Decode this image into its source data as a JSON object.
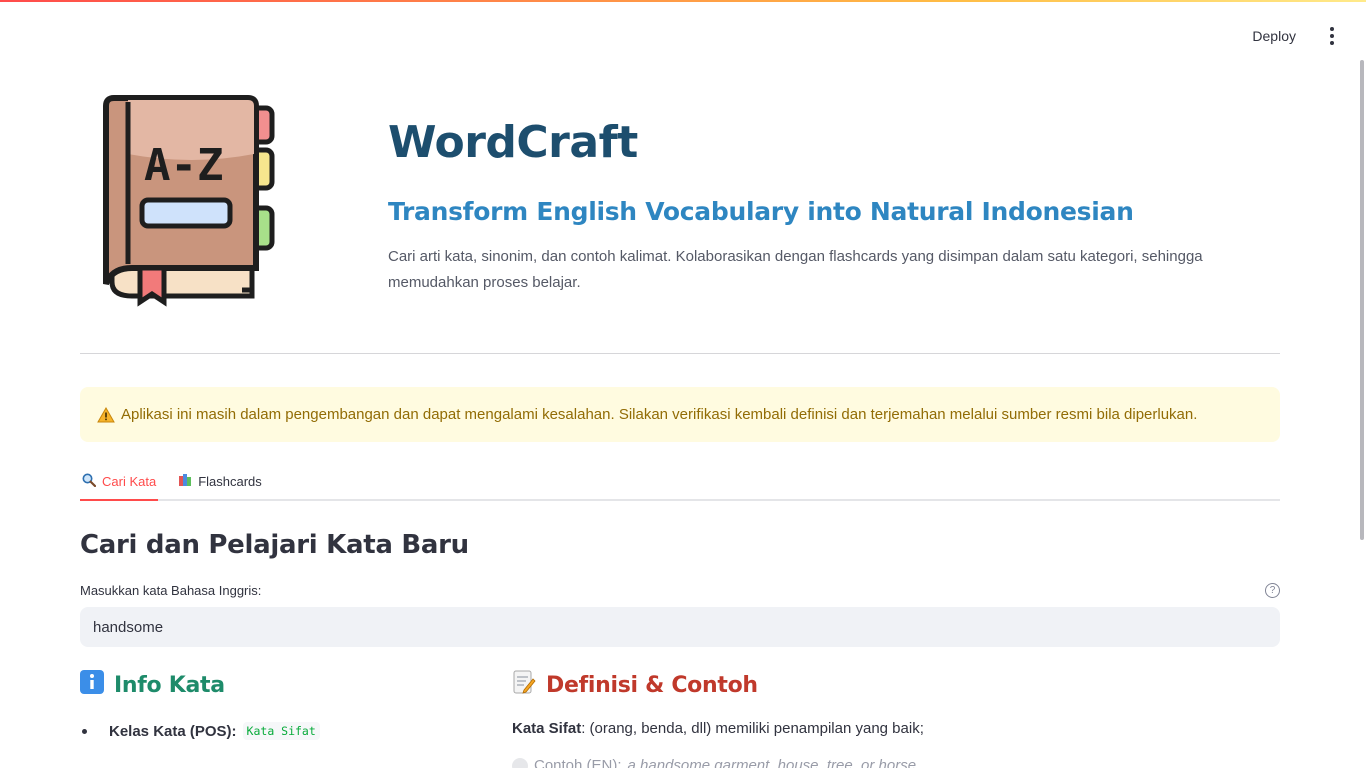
{
  "toolbar": {
    "deploy_label": "Deploy"
  },
  "hero": {
    "logo_text": "A-Z",
    "title": "WordCraft",
    "subtitle": "Transform English Vocabulary into Natural Indonesian",
    "description": "Cari arti kata, sinonim, dan contoh kalimat. Kolaborasikan dengan flashcards yang disimpan dalam satu kategori, sehingga memudahkan proses belajar."
  },
  "warning": {
    "text": "Aplikasi ini masih dalam pengembangan dan dapat mengalami kesalahan. Silakan verifikasi kembali definisi dan terjemahan melalui sumber resmi bila diperlukan."
  },
  "tabs": [
    {
      "label": "Cari Kata",
      "icon": "magnifier-icon",
      "active": true
    },
    {
      "label": "Flashcards",
      "icon": "books-icon",
      "active": false
    }
  ],
  "search": {
    "section_title": "Cari dan Pelajari Kata Baru",
    "label": "Masukkan kata Bahasa Inggris:",
    "value": "handsome"
  },
  "info": {
    "heading": "Info Kata",
    "pos_label": "Kelas Kata (POS):",
    "pos_value": "Kata Sifat"
  },
  "definition": {
    "heading": "Definisi & Contoh",
    "pos_bold": "Kata Sifat",
    "text": ": (orang, benda, dll) memiliki penampilan yang baik;",
    "example_label": "Contoh (EN):",
    "example_text": "a handsome garment, house, tree, or horse"
  },
  "colors": {
    "accent": "#ff4b4b",
    "title": "#1d4e6e",
    "subtitle": "#2e86c1",
    "info_heading": "#1e8b6a",
    "definition_heading": "#c0392b",
    "warning_bg": "#fffbe0",
    "warning_text": "#926c05"
  }
}
